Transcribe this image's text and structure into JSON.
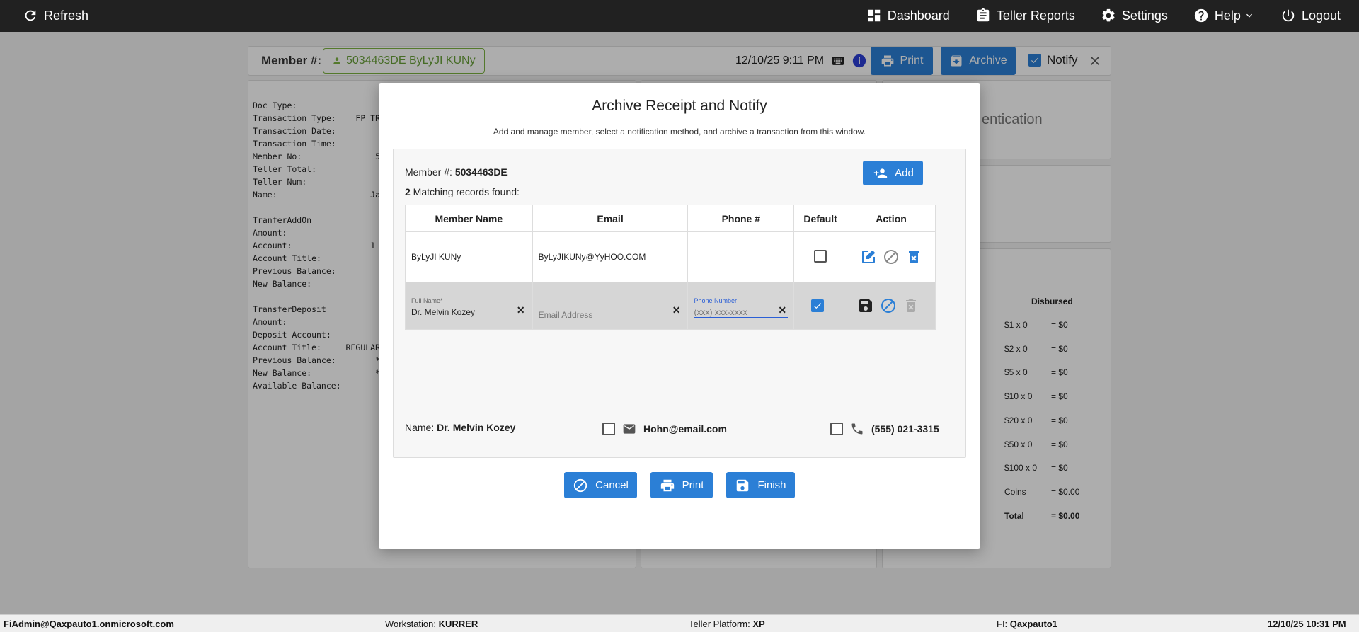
{
  "nav": {
    "refresh": "Refresh",
    "dashboard": "Dashboard",
    "teller_reports": "Teller Reports",
    "settings": "Settings",
    "help": "Help",
    "logout": "Logout"
  },
  "toolbar": {
    "member_label": "Member #:",
    "member_chip": "5034463DE ByLyJI KUNy",
    "datetime": "12/10/25 9:11 PM",
    "print": "Print",
    "archive": "Archive",
    "notify": "Notify"
  },
  "receipt": {
    "lines": [
      "Doc Type:",
      "Transaction Type:    FP TRA",
      "Transaction Date:",
      "Transaction Time:",
      "Member No:               5",
      "Teller Total:",
      "Teller Num:",
      "Name:                   Ja",
      "",
      "TranferAddOn",
      "Amount:",
      "Account:                1",
      "Account Title:",
      "Previous Balance:",
      "New Balance:",
      "",
      "TransferDeposit",
      "Amount:",
      "Deposit Account:",
      "Account Title:     REGULAR",
      "Previous Balance:        *",
      "New Balance:             *",
      "Available Balance:"
    ]
  },
  "auth_panel": {
    "text": "entication"
  },
  "cash": {
    "header": "Disbursed",
    "rows": [
      {
        "d": "$1 x 0",
        "v": "= $0"
      },
      {
        "d": "$2 x 0",
        "v": "= $0"
      },
      {
        "d": "$5 x 0",
        "v": "= $0"
      },
      {
        "d": "$10 x 0",
        "v": "= $0"
      },
      {
        "d": "$20 x 0",
        "v": "= $0"
      },
      {
        "d": "$50 x 0",
        "v": "= $0"
      },
      {
        "d": "$100 x 0",
        "v": "= $0"
      },
      {
        "d": "Coins",
        "v": "= $0.00"
      },
      {
        "d": "Total",
        "v": "= $0.00"
      }
    ]
  },
  "modal": {
    "title": "Archive Receipt and Notify",
    "subtitle": "Add and manage member, select a notification method, and archive a transaction from this window.",
    "member_label": "Member #:",
    "member_value": "5034463DE",
    "count": "2",
    "count_text": " Matching records found:",
    "add": "Add",
    "columns": [
      "Member Name",
      "Email",
      "Phone #",
      "Default",
      "Action"
    ],
    "row1": {
      "name": "ByLyJI KUNy",
      "email": "ByLyJIKUNy@YyHOO.COM",
      "phone": ""
    },
    "row2": {
      "name_label": "Full Name*",
      "name_value": "Dr. Melvin Kozey",
      "email_placeholder": "Email Address",
      "phone_label": "Phone Number",
      "phone_placeholder": "(xxx) xxx-xxxx"
    },
    "name_label": "Name:",
    "name_value": "Dr. Melvin Kozey",
    "email": "Hohn@email.com",
    "phone": "(555) 021-3315",
    "cancel": "Cancel",
    "print": "Print",
    "finish": "Finish"
  },
  "status": {
    "user": "FiAdmin@Qaxpauto1.onmicrosoft.com",
    "workstation_label": "Workstation: ",
    "workstation": "KURRER",
    "platform_label": "Teller Platform: ",
    "platform": "XP",
    "fi_label": "FI: ",
    "fi": "Qaxpauto1",
    "datetime": "12/10/25 10:31 PM"
  },
  "colors": {
    "primary": "#2b7fd6",
    "navbar": "#212121",
    "member_chip": "#7cb342"
  }
}
